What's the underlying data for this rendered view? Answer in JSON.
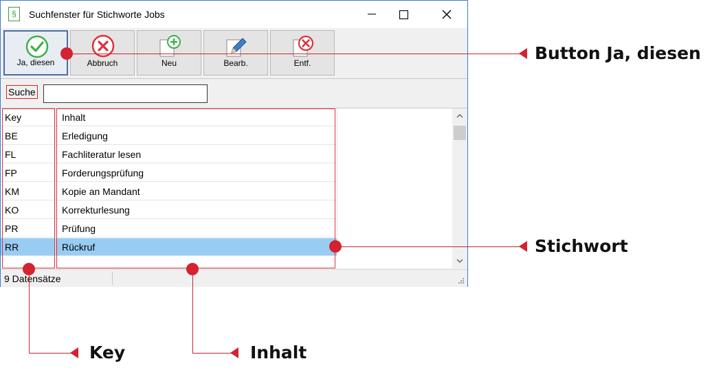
{
  "window": {
    "title": "Suchfenster für Stichworte Jobs",
    "app_icon_glyph": "§"
  },
  "toolbar": [
    {
      "label": "Ja, diesen",
      "icon": "check-icon",
      "active": true
    },
    {
      "label": "Abbruch",
      "icon": "cancel-icon"
    },
    {
      "label": "Neu",
      "icon": "new-doc-icon"
    },
    {
      "label": "Bearb.",
      "icon": "edit-icon"
    },
    {
      "label": "Entf.",
      "icon": "delete-doc-icon"
    }
  ],
  "search": {
    "label": "Suche",
    "value": ""
  },
  "table": {
    "columns": [
      "Key",
      "Inhalt"
    ],
    "rows": [
      {
        "key": "BE",
        "value": "Erledigung"
      },
      {
        "key": "FL",
        "value": "Fachliteratur lesen"
      },
      {
        "key": "FP",
        "value": "Forderungsprüfung"
      },
      {
        "key": "KM",
        "value": "Kopie an Mandant"
      },
      {
        "key": "KO",
        "value": "Korrekturlesung"
      },
      {
        "key": "PR",
        "value": "Prüfung"
      },
      {
        "key": "RR",
        "value": "Rückruf",
        "selected": true
      }
    ]
  },
  "status": {
    "text": "9 Datensätze"
  },
  "annotations": {
    "button": "Button Ja, diesen",
    "stichwort": "Stichwort",
    "key": "Key",
    "inhalt": "Inhalt"
  },
  "colors": {
    "annotation": "#d3232f",
    "selection": "#99ccf3",
    "accent_green": "#3fae49",
    "cancel_red": "#e0303a"
  }
}
